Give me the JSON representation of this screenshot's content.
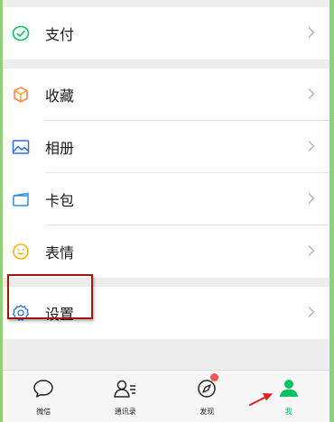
{
  "menu": {
    "pay": {
      "label": "支付",
      "icon": "pay-icon"
    },
    "favorites": {
      "label": "收藏",
      "icon": "favorites-cube-icon"
    },
    "album": {
      "label": "相册",
      "icon": "album-image-icon"
    },
    "cards": {
      "label": "卡包",
      "icon": "card-wallet-icon"
    },
    "stickers": {
      "label": "表情",
      "icon": "sticker-smile-icon"
    },
    "settings": {
      "label": "设置",
      "icon": "settings-gear-icon"
    }
  },
  "tabbar": {
    "tabs": [
      {
        "label": "微信",
        "icon": "chat-bubble-icon",
        "active": false
      },
      {
        "label": "通讯录",
        "icon": "contacts-icon",
        "active": false
      },
      {
        "label": "发现",
        "icon": "discover-compass-icon",
        "active": false,
        "badge": "red-dot"
      },
      {
        "label": "我",
        "icon": "me-person-icon",
        "active": true
      }
    ]
  },
  "colors": {
    "accent_green": "#07c160",
    "highlight_border": "#a31515",
    "annotation_arrow": "#e02020",
    "badge_red": "#fa5151"
  }
}
